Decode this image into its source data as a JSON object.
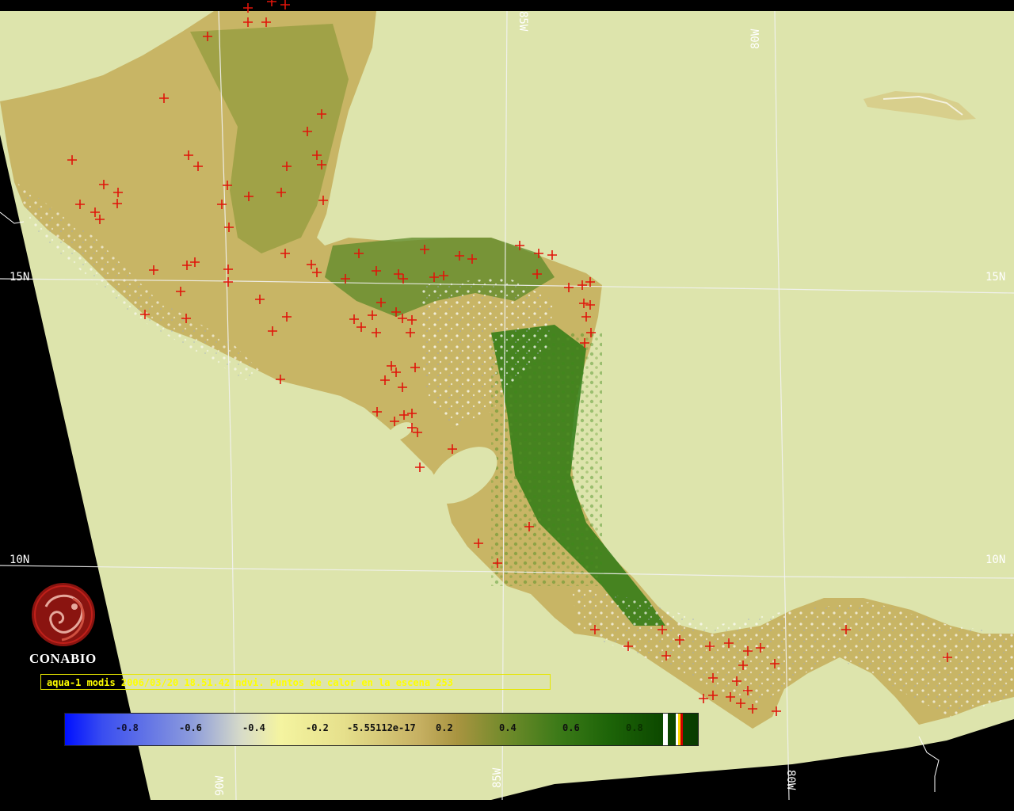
{
  "map": {
    "grid_labels": {
      "lat_15n_left": "15N",
      "lat_15n_right": "15N",
      "lat_10n_left": "10N",
      "lat_10n_right": "10N",
      "lon_85w_top": "85W",
      "lon_80w_top": "80W",
      "lon_90w_bottom": "90W",
      "lon_85w_bottom": "85W",
      "lon_80w_bottom": "80W"
    },
    "colors": {
      "space": "#000000",
      "ocean": "#dde4ac",
      "land_low": "#c9b468",
      "land_mid": "#8e9a3a",
      "land_high": "#2f7a14",
      "cloud": "#ffffff",
      "hotspot": "#e0140a",
      "grid": "#f2f2f2"
    }
  },
  "logo": {
    "text": "CONABIO",
    "icon": "conabio-seal-icon"
  },
  "caption": {
    "text": "aqua-1 modis 2006/03/20 18.51.42 ndvi. Puntos de calor en la escena 253"
  },
  "colorbar": {
    "ticks": [
      "-0.8",
      "-0.6",
      "-0.4",
      "-0.2",
      "-5.55112e-17",
      "0.2",
      "0.4",
      "0.6",
      "0.8"
    ]
  }
}
